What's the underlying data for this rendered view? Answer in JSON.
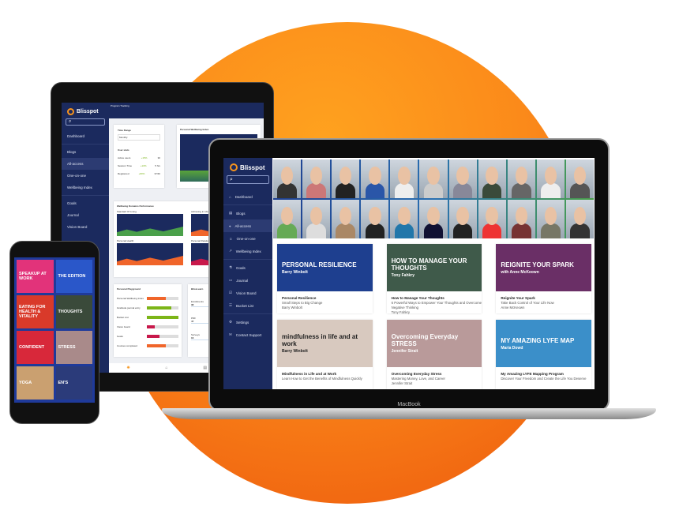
{
  "brand": "Blisspot",
  "colors": {
    "accent": "#f7941d",
    "sidebar": "#1b2a5e",
    "circle": "#fb8a1a"
  },
  "laptop": {
    "model": "MacBook",
    "nav": [
      {
        "icon": "home-icon",
        "label": "Dashboard"
      },
      {
        "icon": "blog-icon",
        "label": "Blogs"
      },
      {
        "icon": "graduation-cap-icon",
        "label": "All-access",
        "active": true
      },
      {
        "icon": "person-chat-icon",
        "label": "One-on-one"
      },
      {
        "icon": "trend-icon",
        "label": "Wellbeing Index"
      },
      {
        "icon": "flask-icon",
        "label": "Goals"
      },
      {
        "icon": "book-icon",
        "label": "Journal"
      },
      {
        "icon": "vision-board-icon",
        "label": "Vision Board"
      },
      {
        "icon": "list-icon",
        "label": "Bucket List"
      },
      {
        "icon": "gear-icon",
        "label": "Settings"
      },
      {
        "icon": "mail-icon",
        "label": "Contact Support"
      }
    ],
    "cards": [
      {
        "thumb_title": "PERSONAL RESILIENCE",
        "thumb_sub": "Barry Winbolt",
        "bg": "#1e3f8f",
        "title": "Personal Resilience",
        "desc": "Small Steps to Big Change",
        "author": "Barry Winbolt"
      },
      {
        "thumb_title": "HOW TO MANAGE YOUR THOUGHTS",
        "thumb_sub": "Tony Fahkry",
        "bg": "#3f5a4a",
        "title": "How to Manage Your Thoughts",
        "desc": "6 Powerful Ways to Empower Your Thoughts and Overcome Negative Thinking",
        "author": "Tony Fahkry"
      },
      {
        "thumb_title": "REIGNITE YOUR SPARK",
        "thumb_sub": "with Anne McKeown",
        "bg": "#6a2f66",
        "title": "Reignite Your Spark",
        "desc": "Take Back Control of Your Life Now",
        "author": "Anne McKeown"
      },
      {
        "thumb_title": "mindfulness in life and at work",
        "thumb_sub": "Barry Winbolt",
        "bg": "#d8c9bf",
        "title": "Mindfulness in Life and at Work",
        "desc": "Learn How to Get the Benefits of Mindfulness Quickly",
        "author": ""
      },
      {
        "thumb_title": "Overcoming Everyday STRESS",
        "thumb_sub": "Jennifer Strait",
        "bg": "#b99a9a",
        "title": "Overcoming Everyday Stress",
        "desc": "Mastering Money, Love, and Career",
        "author": "Jennifer Strait"
      },
      {
        "thumb_title": "MY AMAZING LYFE MAP",
        "thumb_sub": "Maria Dowd",
        "bg": "#3b8fc9",
        "title": "My Amazing LYFE Mapping Program",
        "desc": "Discover Your Freedom and Create the Life You Deserve",
        "author": ""
      }
    ]
  },
  "tablet": {
    "header": "Program Tracking",
    "nav": [
      "Dashboard",
      "Blogs",
      "All-access",
      "One-on-one",
      "Wellbeing Index",
      "Goals",
      "Journal",
      "Vision Board"
    ],
    "time_range": {
      "label": "Time Range",
      "value": "Monthly"
    },
    "user_stats": {
      "label": "User stats",
      "rows": [
        {
          "k": "Active users",
          "p": "+15%",
          "v": "30"
        },
        {
          "k": "Session Time",
          "p": "+10%",
          "v": "5 hrs"
        },
        {
          "k": "Registered",
          "p": "+80%",
          "v": "37/40"
        }
      ]
    },
    "wellbeing_index": "Personal Wellbeing Index",
    "domains": {
      "title": "Wellbeing Domains Performance",
      "charts": [
        "Standard Of Living",
        "Achieving in Life",
        "Personal Health",
        "Personal Relationships"
      ]
    },
    "playground": {
      "title": "Personal Playground",
      "rows": [
        {
          "k": "Personal Wellbeing Index",
          "v": 0.6,
          "c": "#f0652a"
        },
        {
          "k": "Gratitude journal entry",
          "v": 0.78,
          "c": "#7cb518"
        },
        {
          "k": "Bucket List",
          "v": 1.0,
          "c": "#7cb518"
        },
        {
          "k": "Vision board",
          "v": 0.25,
          "c": "#c8194b"
        },
        {
          "k": "Goals",
          "v": 0.4,
          "c": "#c8194b"
        },
        {
          "k": "Courses completed",
          "v": 0.6,
          "c": "#f0652a"
        }
      ]
    },
    "blisslearn": {
      "title": "BlissLearn",
      "rows": [
        {
          "k": "Enrollments",
          "v": "38"
        },
        {
          "k": "PDF",
          "v": "47"
        },
        {
          "k": "Surveys",
          "v": "16"
        }
      ]
    }
  },
  "phone": {
    "tiles": [
      {
        "t": "SPEAKUP AT WORK",
        "bg": "#e2337a"
      },
      {
        "t": "THE EDITION",
        "bg": "#2a57c9"
      },
      {
        "t": "EATING FOR HEALTH & VITALITY",
        "bg": "#d93a2a"
      },
      {
        "t": "THOUGHTS",
        "bg": "#3a4a3a"
      },
      {
        "t": "CONFIDENT",
        "bg": "#d8283a"
      },
      {
        "t": "STRESS",
        "bg": "#a98a8a"
      },
      {
        "t": "YOGA",
        "bg": "#caa070"
      },
      {
        "t": "EN'S",
        "bg": "#2b3b7a"
      }
    ]
  }
}
